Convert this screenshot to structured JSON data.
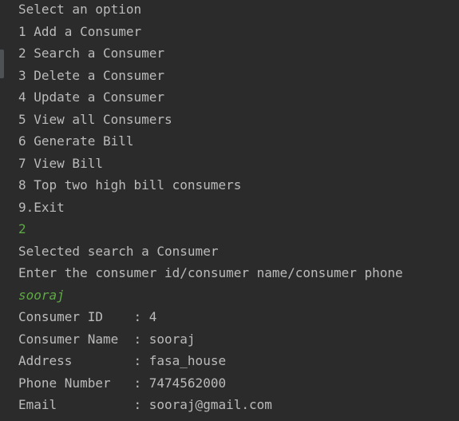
{
  "console": {
    "prompt": "Select an option",
    "menu": [
      "1 Add a Consumer",
      "2 Search a Consumer",
      "3 Delete a Consumer",
      "4 Update a Consumer",
      "5 View all Consumers",
      "6 Generate Bill",
      "7 View Bill",
      "8 Top two high bill consumers",
      "9.Exit"
    ],
    "user_choice": "2",
    "selected_message": "Selected search a Consumer",
    "enter_prompt": "Enter the consumer id/consumer name/consumer phone",
    "user_query": "sooraj",
    "result": [
      "Consumer ID    : 4",
      "Consumer Name  : sooraj",
      "Address        : fasa_house",
      "Phone Number   : 7474562000",
      "Email          : sooraj@gmail.com"
    ]
  },
  "colors": {
    "background": "#2b2b2b",
    "text": "#bbbbbb",
    "user_input": "#5fa846"
  }
}
